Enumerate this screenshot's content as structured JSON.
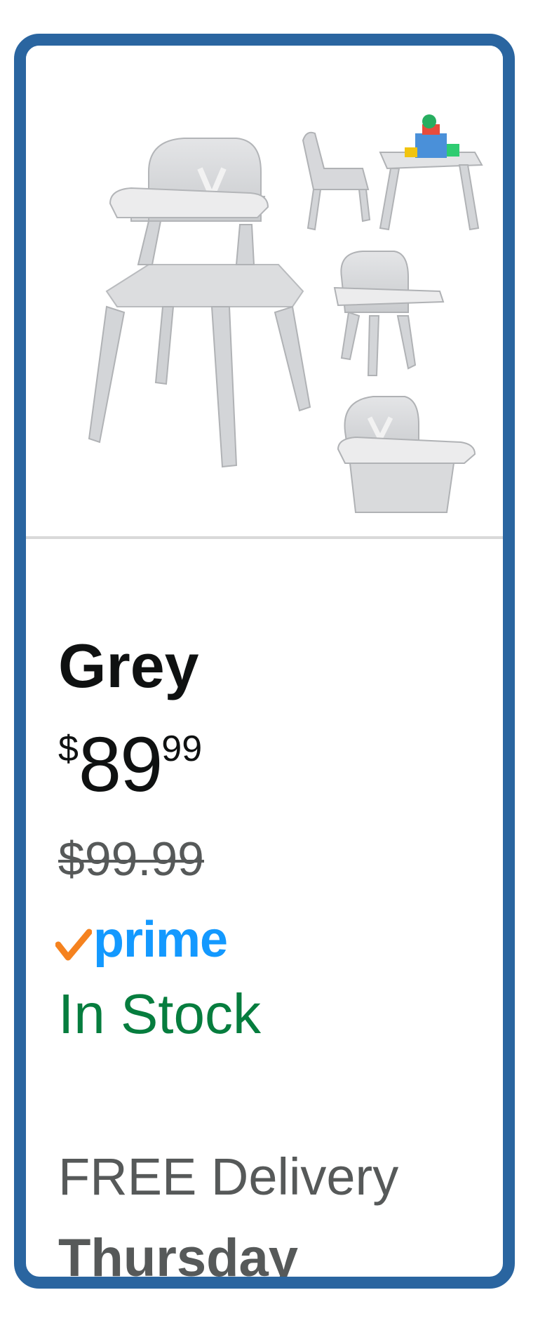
{
  "product_card": {
    "variant_name": "Grey",
    "price": {
      "symbol": "$",
      "whole": "89",
      "fraction": "99"
    },
    "list_price": "$99.99",
    "prime_label": "prime",
    "availability": "In Stock",
    "delivery_text": "FREE Delivery",
    "delivery_day": "Thursday",
    "image_alt": "Grey 6-in-1 convertible baby high chair shown in multiple configurations"
  },
  "colors": {
    "border": "#2a65a0",
    "stock_green": "#067d3e",
    "prime_blue": "#1399ff",
    "prime_check": "#f5821f",
    "muted_text": "#565959"
  }
}
